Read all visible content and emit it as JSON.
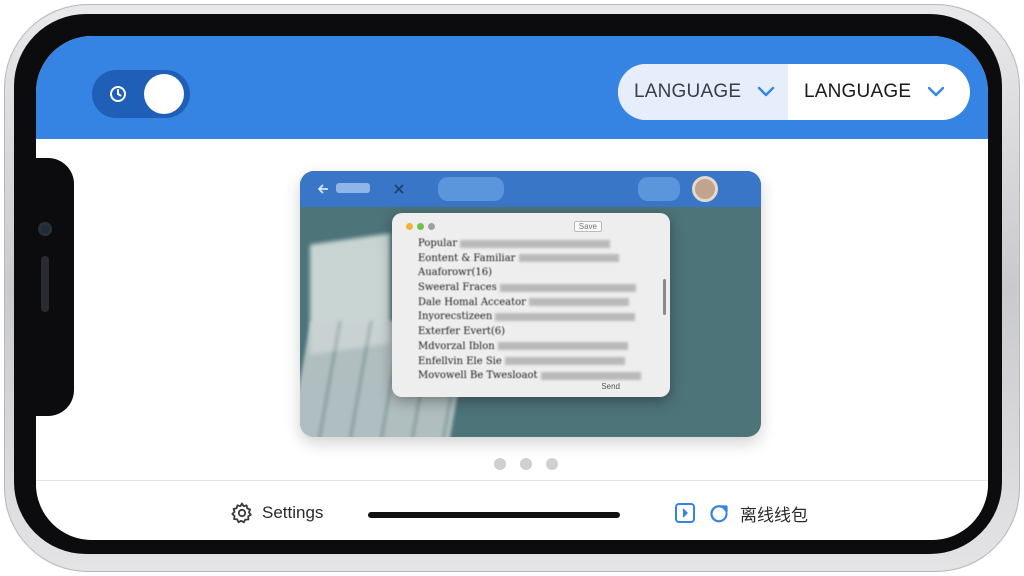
{
  "header": {
    "toggle": {
      "state": "on"
    },
    "source_language": "LANGUAGE",
    "target_language": "LANGUAGE"
  },
  "preview": {
    "dialog_lines": [
      "Popular",
      "Eontent & Familiar",
      "Auaforowr(16)",
      "Sweeral Fraces",
      "Dale Homal Acceator",
      "Inyorecstizeen",
      "Exterfer Evert(6)",
      "Mdvorzal Iblon",
      "Enfellvin Ele Sie",
      "Movowell Be Twesloaot"
    ],
    "save_label": "Save",
    "footer_label": "Send"
  },
  "pager": {
    "count": 3,
    "active": 0
  },
  "footer": {
    "settings_label": "Settings",
    "offline_label": "离线线包"
  },
  "colors": {
    "header": "#3584e4",
    "toggle_track": "#1f5fb8",
    "source_bg": "#e6eefc",
    "accent": "#3584e4"
  },
  "icons": {
    "toggle": "clock-icon",
    "chevron": "chevron-down-icon",
    "settings": "gear-icon",
    "offline_a": "download-box-icon",
    "offline_b": "refresh-icon"
  }
}
